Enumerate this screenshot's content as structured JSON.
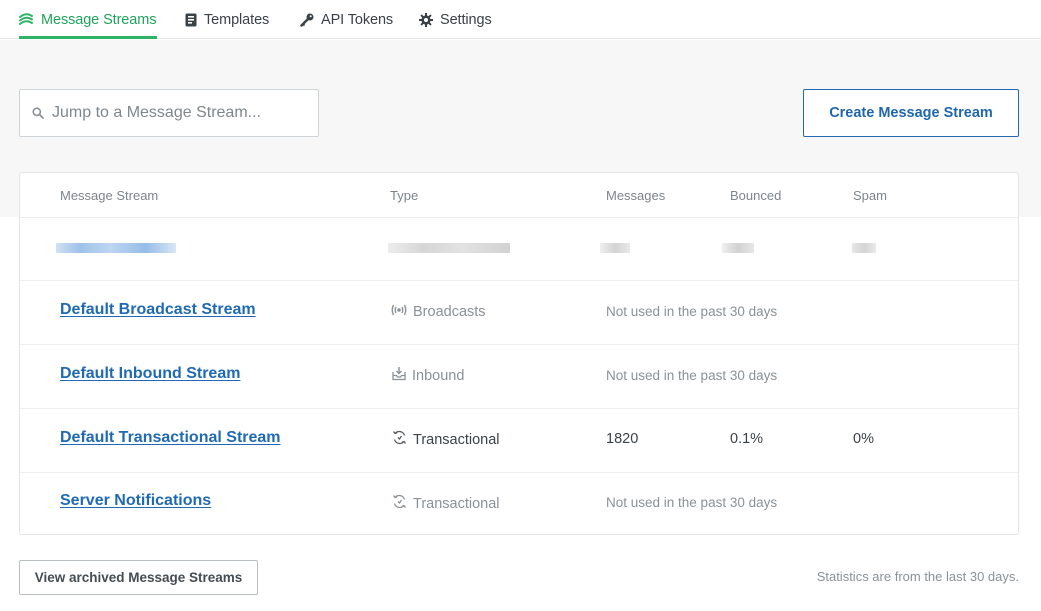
{
  "nav": {
    "tabs": [
      {
        "label": "Message Streams",
        "icon": "streams-icon",
        "active": true
      },
      {
        "label": "Templates",
        "icon": "template-icon",
        "active": false
      },
      {
        "label": "API Tokens",
        "icon": "key-icon",
        "active": false
      },
      {
        "label": "Settings",
        "icon": "gear-icon",
        "active": false
      }
    ]
  },
  "search": {
    "placeholder": "Jump to a Message Stream..."
  },
  "actions": {
    "create_label": "Create Message Stream"
  },
  "table": {
    "headers": {
      "stream": "Message Stream",
      "type": "Type",
      "messages": "Messages",
      "bounced": "Bounced",
      "spam": "Spam"
    },
    "rows": [
      {
        "name": "Default Broadcast Stream",
        "type": "Broadcasts",
        "type_icon": "broadcast-icon",
        "status": "Not used in the past 30 days"
      },
      {
        "name": "Default Inbound Stream",
        "type": "Inbound",
        "type_icon": "inbox-icon",
        "status": "Not used in the past 30 days"
      },
      {
        "name": "Default Transactional Stream",
        "type": "Transactional",
        "type_icon": "transactional-icon",
        "messages": "1820",
        "bounced": "0.1%",
        "spam": "0%"
      },
      {
        "name": "Server Notifications",
        "type": "Transactional",
        "type_icon": "transactional-icon",
        "status": "Not used in the past 30 days"
      }
    ]
  },
  "footer": {
    "archived_label": "View archived Message Streams",
    "note": "Statistics are from the last 30 days."
  },
  "colors": {
    "accent_green": "#2eb364",
    "link_blue": "#1f6ab5",
    "background_grey": "#f7f7f8"
  }
}
